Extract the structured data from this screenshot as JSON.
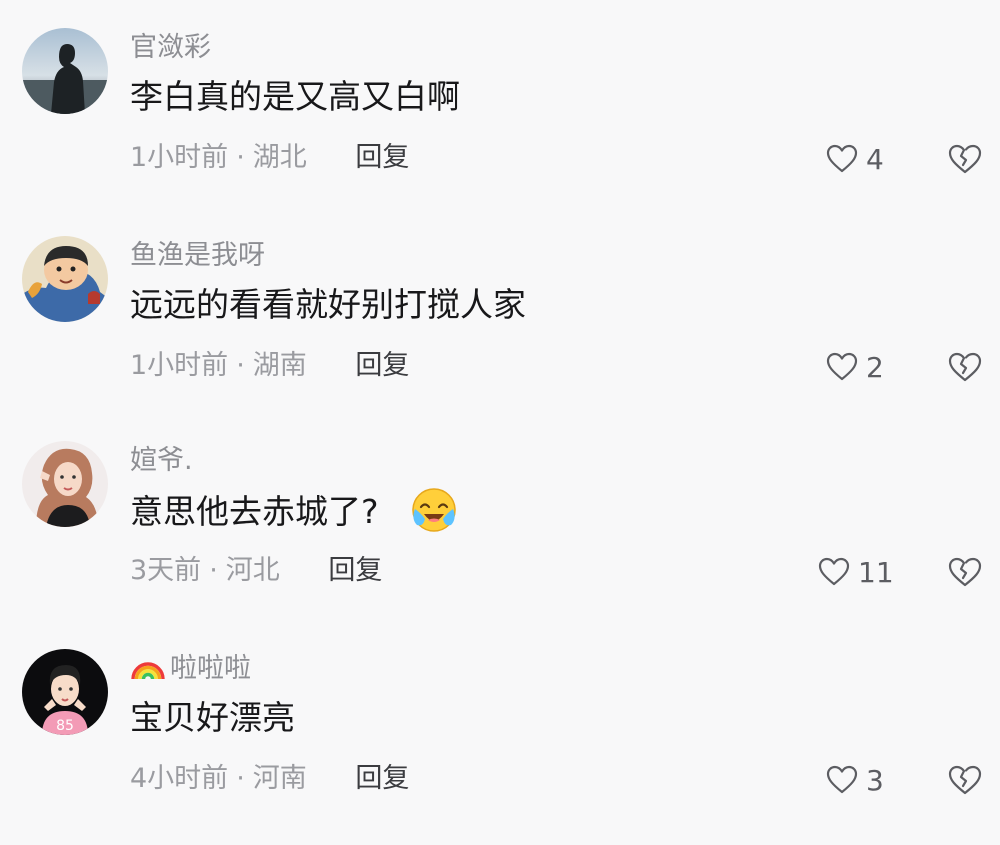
{
  "comments": [
    {
      "username": "官潋彩",
      "text": "李白真的是又高又白啊",
      "time": "1小时前",
      "separator": "·",
      "location": "湖北",
      "reply_label": "回复",
      "likes": "4",
      "avatar": "person-silhouette-avatar"
    },
    {
      "username": "鱼渔是我呀",
      "text": "远远的看看就好别打搅人家",
      "time": "1小时前",
      "separator": "·",
      "location": "湖南",
      "reply_label": "回复",
      "likes": "2",
      "avatar": "cartoon-character-avatar"
    },
    {
      "username": "媗爷.",
      "text": "意思他去赤城了?",
      "time": "3天前",
      "separator": "·",
      "location": "河北",
      "reply_label": "回复",
      "likes": "11",
      "avatar": "girl-selfie-avatar",
      "emoji": "crying-laughing-emoji"
    },
    {
      "username": "啦啦啦",
      "username_prefix_icon": "rainbow-icon",
      "text": "宝贝好漂亮",
      "time": "4小时前",
      "separator": "·",
      "location": "河南",
      "reply_label": "回复",
      "likes": "3",
      "avatar": "cartoon-boy-avatar"
    }
  ],
  "colors": {
    "background": "#f8f8f9",
    "username": "#8d8e93",
    "content": "#18181a",
    "meta": "#9a9ba0",
    "reply": "#3b3c40",
    "icon": "#5c5d62"
  }
}
